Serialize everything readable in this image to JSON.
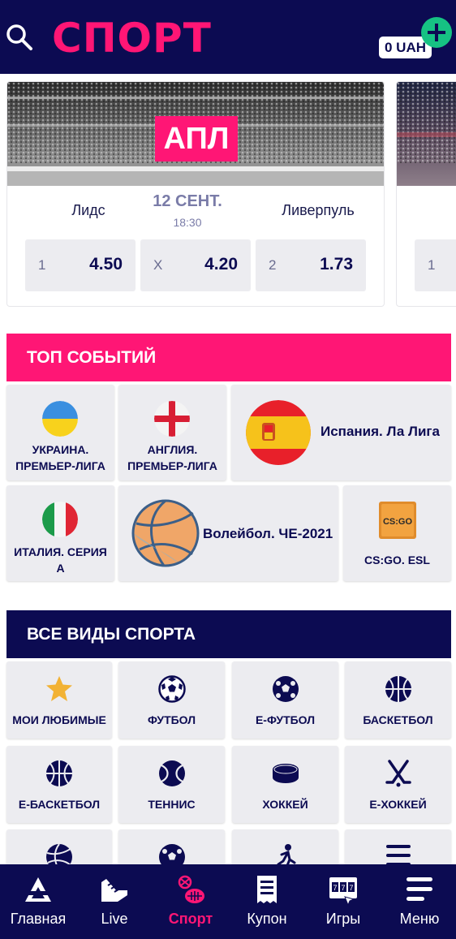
{
  "header": {
    "title": "СПОРТ",
    "balance": "0 UAH",
    "icons": {
      "search": "search-icon",
      "add": "plus-icon"
    }
  },
  "featured_match": {
    "league_badge": "АПЛ",
    "home_team": "Лидс",
    "away_team": "Ливерпуль",
    "date": "12 СЕНТ.",
    "time": "18:30",
    "odds": [
      {
        "label": "1",
        "value": "4.50"
      },
      {
        "label": "X",
        "value": "4.20"
      },
      {
        "label": "2",
        "value": "1.73"
      }
    ],
    "next_card_odd_label": "1"
  },
  "top_events": {
    "title": "ТОП СОБЫТИЙ",
    "items": [
      {
        "label": "УКРАИНА. ПРЕМЬЕР-ЛИГА",
        "icon": "ukraine-flag-icon"
      },
      {
        "label": "АНГЛИЯ. ПРЕМЬЕР-ЛИГА",
        "icon": "england-flag-icon"
      },
      {
        "label": "Испания. Ла Лига",
        "icon": "spain-flag-icon"
      },
      {
        "label": "ИТАЛИЯ. СЕРИЯ А",
        "icon": "italy-flag-icon"
      },
      {
        "label": "Волейбол. ЧЕ-2021",
        "icon": "volleyball-icon"
      },
      {
        "label": "CS:GO. ESL",
        "icon": "csgo-icon"
      }
    ]
  },
  "all_sports": {
    "title": "ВСЕ ВИДЫ СПОРТА",
    "items": [
      {
        "label": "МОИ ЛЮБИМЫЕ",
        "icon": "star-icon"
      },
      {
        "label": "ФУТБОЛ",
        "icon": "soccer-ball-icon"
      },
      {
        "label": "Е-ФУТБОЛ",
        "icon": "esoccer-ball-icon"
      },
      {
        "label": "БАСКЕТБОЛ",
        "icon": "basketball-icon"
      },
      {
        "label": "Е-БАСКЕТБОЛ",
        "icon": "ebasketball-icon"
      },
      {
        "label": "ТЕННИС",
        "icon": "tennis-ball-icon"
      },
      {
        "label": "ХОККЕЙ",
        "icon": "hockey-puck-icon"
      },
      {
        "label": "Е-ХОККЕЙ",
        "icon": "hockey-sticks-icon"
      }
    ],
    "partial_row_icons": [
      "volleyball-icon",
      "soccer-ball-icon",
      "runner-icon",
      "menu-lines-icon"
    ]
  },
  "bottom_nav": {
    "items": [
      {
        "label": "Главная",
        "icon": "home-logo-icon"
      },
      {
        "label": "Live",
        "icon": "live-icon"
      },
      {
        "label": "Спорт",
        "icon": "sport-icon",
        "active": true
      },
      {
        "label": "Купон",
        "icon": "coupon-icon"
      },
      {
        "label": "Игры",
        "icon": "slot-machine-icon"
      },
      {
        "label": "Меню",
        "icon": "hamburger-icon"
      }
    ]
  },
  "colors": {
    "navy": "#0c0b52",
    "pink": "#ff1675",
    "green": "#16c283",
    "tile_bg": "#ececf0"
  }
}
